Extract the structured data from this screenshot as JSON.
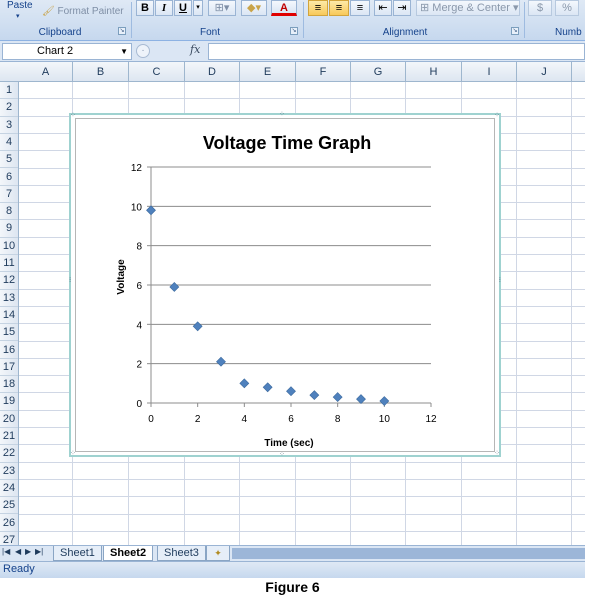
{
  "ribbon": {
    "clipboard": {
      "paste_label": "Paste",
      "format_painter_label": "Format Painter",
      "group_label": "Clipboard"
    },
    "font": {
      "bold_label": "B",
      "italic_label": "I",
      "underline_label": "U",
      "font_color_label": "A",
      "group_label": "Font"
    },
    "alignment": {
      "merge_center_label": "Merge & Center",
      "group_label": "Alignment"
    },
    "number": {
      "currency_label": "$",
      "percent_label": "%",
      "group_label": "Numb"
    }
  },
  "formula_bar": {
    "name_box_value": "Chart 2",
    "fx_label": "fx",
    "formula_value": ""
  },
  "columns": [
    "A",
    "B",
    "C",
    "D",
    "E",
    "F",
    "G",
    "H",
    "I",
    "J"
  ],
  "rows": [
    "1",
    "2",
    "3",
    "4",
    "5",
    "6",
    "7",
    "8",
    "9",
    "10",
    "11",
    "12",
    "13",
    "14",
    "15",
    "16",
    "17",
    "18",
    "19",
    "20",
    "21",
    "22",
    "23",
    "24",
    "25",
    "26",
    "27"
  ],
  "sheet_tabs": [
    {
      "label": "Sheet1",
      "active": false
    },
    {
      "label": "Sheet2",
      "active": true
    },
    {
      "label": "Sheet3",
      "active": false
    }
  ],
  "status": {
    "ready_label": "Ready"
  },
  "caption": "Figure 6",
  "colors": {
    "marker": "#4f81bd",
    "chart_border": "#9fd2d0",
    "gridline": "#8c8c8c"
  },
  "chart_data": {
    "type": "scatter",
    "title": "Voltage Time Graph",
    "xlabel": "Time (sec)",
    "ylabel": "Voltage",
    "xlim": [
      0,
      12
    ],
    "ylim": [
      0,
      12
    ],
    "xticks": [
      0,
      2,
      4,
      6,
      8,
      10,
      12
    ],
    "yticks": [
      0,
      2,
      4,
      6,
      8,
      10,
      12
    ],
    "grid": "horizontal",
    "legend": "none",
    "marker": "diamond",
    "points": [
      {
        "x": 0,
        "y": 9.8
      },
      {
        "x": 1,
        "y": 5.9
      },
      {
        "x": 2,
        "y": 3.9
      },
      {
        "x": 3,
        "y": 2.1
      },
      {
        "x": 4,
        "y": 1.0
      },
      {
        "x": 5,
        "y": 0.8
      },
      {
        "x": 6,
        "y": 0.6
      },
      {
        "x": 7,
        "y": 0.4
      },
      {
        "x": 8,
        "y": 0.3
      },
      {
        "x": 9,
        "y": 0.2
      },
      {
        "x": 10,
        "y": 0.1
      }
    ]
  }
}
